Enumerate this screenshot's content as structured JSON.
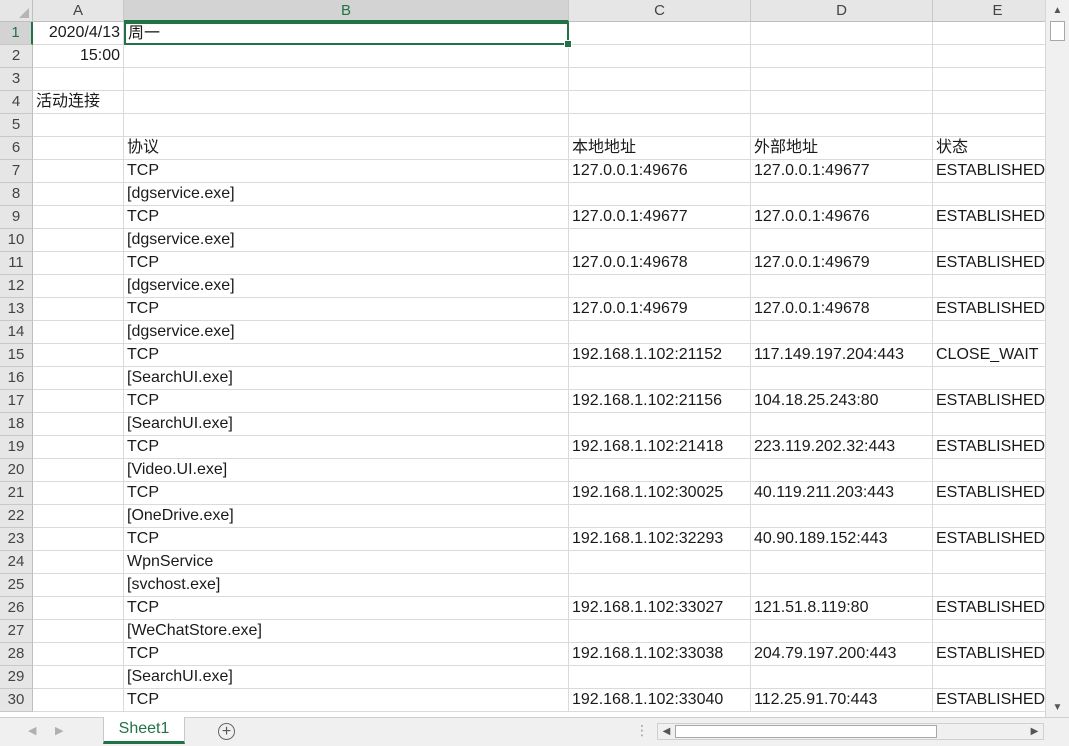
{
  "columns": [
    {
      "id": "col-a",
      "label": "A"
    },
    {
      "id": "col-b",
      "label": "B"
    },
    {
      "id": "col-c",
      "label": "C"
    },
    {
      "id": "col-d",
      "label": "D"
    },
    {
      "id": "col-e",
      "label": "E"
    }
  ],
  "rows": [
    {
      "n": "1",
      "cells": [
        "2020/4/13",
        "周一",
        "",
        "",
        ""
      ]
    },
    {
      "n": "2",
      "cells": [
        "15:00",
        "",
        "",
        "",
        ""
      ]
    },
    {
      "n": "3",
      "cells": [
        "",
        "",
        "",
        "",
        ""
      ]
    },
    {
      "n": "4",
      "cells": [
        "活动连接",
        "",
        "",
        "",
        ""
      ]
    },
    {
      "n": "5",
      "cells": [
        "",
        "",
        "",
        "",
        ""
      ]
    },
    {
      "n": "6",
      "cells": [
        "",
        "协议",
        "本地地址",
        "外部地址",
        "状态"
      ]
    },
    {
      "n": "7",
      "cells": [
        "",
        "TCP",
        "127.0.0.1:49676",
        "127.0.0.1:49677",
        "ESTABLISHED"
      ]
    },
    {
      "n": "8",
      "cells": [
        "",
        "[dgservice.exe]",
        "",
        "",
        ""
      ]
    },
    {
      "n": "9",
      "cells": [
        "",
        "TCP",
        "127.0.0.1:49677",
        "127.0.0.1:49676",
        "ESTABLISHED"
      ]
    },
    {
      "n": "10",
      "cells": [
        "",
        "[dgservice.exe]",
        "",
        "",
        ""
      ]
    },
    {
      "n": "11",
      "cells": [
        "",
        "TCP",
        "127.0.0.1:49678",
        "127.0.0.1:49679",
        "ESTABLISHED"
      ]
    },
    {
      "n": "12",
      "cells": [
        "",
        "[dgservice.exe]",
        "",
        "",
        ""
      ]
    },
    {
      "n": "13",
      "cells": [
        "",
        "TCP",
        "127.0.0.1:49679",
        "127.0.0.1:49678",
        "ESTABLISHED"
      ]
    },
    {
      "n": "14",
      "cells": [
        "",
        "[dgservice.exe]",
        "",
        "",
        ""
      ]
    },
    {
      "n": "15",
      "cells": [
        "",
        "TCP",
        "192.168.1.102:21152",
        "117.149.197.204:443",
        "CLOSE_WAIT"
      ]
    },
    {
      "n": "16",
      "cells": [
        "",
        "[SearchUI.exe]",
        "",
        "",
        ""
      ]
    },
    {
      "n": "17",
      "cells": [
        "",
        "TCP",
        "192.168.1.102:21156",
        "104.18.25.243:80",
        "ESTABLISHED"
      ]
    },
    {
      "n": "18",
      "cells": [
        "",
        "[SearchUI.exe]",
        "",
        "",
        ""
      ]
    },
    {
      "n": "19",
      "cells": [
        "",
        "TCP",
        "192.168.1.102:21418",
        "223.119.202.32:443",
        "ESTABLISHED"
      ]
    },
    {
      "n": "20",
      "cells": [
        "",
        "[Video.UI.exe]",
        "",
        "",
        ""
      ]
    },
    {
      "n": "21",
      "cells": [
        "",
        "TCP",
        "192.168.1.102:30025",
        "40.119.211.203:443",
        "ESTABLISHED"
      ]
    },
    {
      "n": "22",
      "cells": [
        "",
        "[OneDrive.exe]",
        "",
        "",
        ""
      ]
    },
    {
      "n": "23",
      "cells": [
        "",
        "TCP",
        "192.168.1.102:32293",
        "40.90.189.152:443",
        "ESTABLISHED"
      ]
    },
    {
      "n": "24",
      "cells": [
        "",
        "WpnService",
        "",
        "",
        ""
      ]
    },
    {
      "n": "25",
      "cells": [
        "",
        "[svchost.exe]",
        "",
        "",
        ""
      ]
    },
    {
      "n": "26",
      "cells": [
        "",
        "TCP",
        "192.168.1.102:33027",
        "121.51.8.119:80",
        "ESTABLISHED"
      ]
    },
    {
      "n": "27",
      "cells": [
        "",
        "[WeChatStore.exe]",
        "",
        "",
        ""
      ]
    },
    {
      "n": "28",
      "cells": [
        "",
        "TCP",
        "192.168.1.102:33038",
        "204.79.197.200:443",
        "ESTABLISHED"
      ]
    },
    {
      "n": "29",
      "cells": [
        "",
        "[SearchUI.exe]",
        "",
        "",
        ""
      ]
    },
    {
      "n": "30",
      "cells": [
        "",
        "TCP",
        "192.168.1.102:33040",
        "112.25.91.70:443",
        "ESTABLISHED"
      ]
    }
  ],
  "selection": {
    "cell": "B1",
    "col": "B",
    "row": "1"
  },
  "sheet_tab": {
    "label": "Sheet1"
  },
  "icons": {
    "add_sheet": "plus-circle-icon",
    "prev_sheet": "chevron-left-icon",
    "next_sheet": "chevron-right-icon",
    "scroll_up": "triangle-up-icon",
    "scroll_down": "triangle-down-icon",
    "scroll_left": "triangle-left-icon",
    "scroll_right": "triangle-right-icon"
  },
  "colors": {
    "accent": "#217346",
    "header_bg": "#e6e6e6",
    "grid": "#dadada"
  }
}
